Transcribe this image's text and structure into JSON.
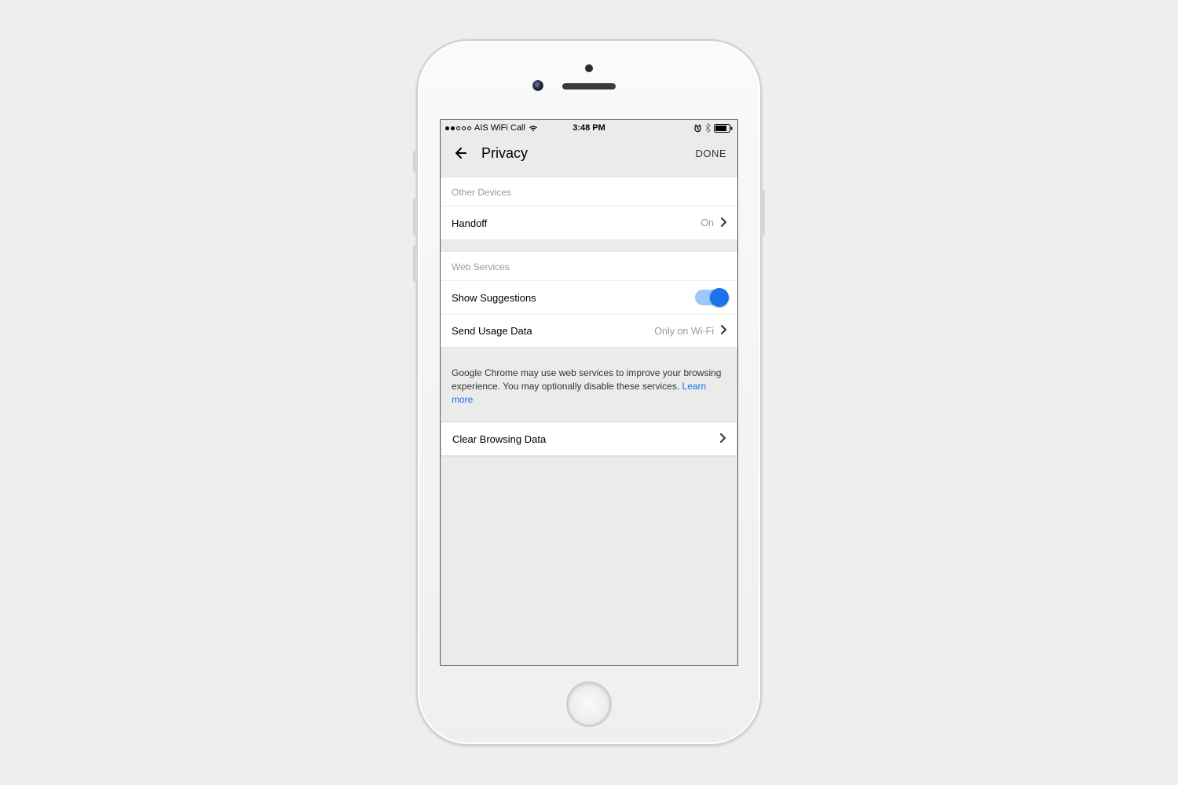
{
  "statusbar": {
    "carrier": "AIS WiFi Call",
    "time": "3:48 PM"
  },
  "nav": {
    "title": "Privacy",
    "done_label": "DONE"
  },
  "sections": {
    "other_devices": {
      "header": "Other Devices",
      "handoff_label": "Handoff",
      "handoff_value": "On"
    },
    "web_services": {
      "header": "Web Services",
      "show_suggestions_label": "Show Suggestions",
      "send_usage_label": "Send Usage Data",
      "send_usage_value": "Only on Wi-Fi"
    }
  },
  "footnote": {
    "text": "Google Chrome may use web services to improve your browsing experience. You may optionally disable these services. ",
    "link_label": "Learn more"
  },
  "clear_browsing": {
    "label": "Clear Browsing Data"
  }
}
